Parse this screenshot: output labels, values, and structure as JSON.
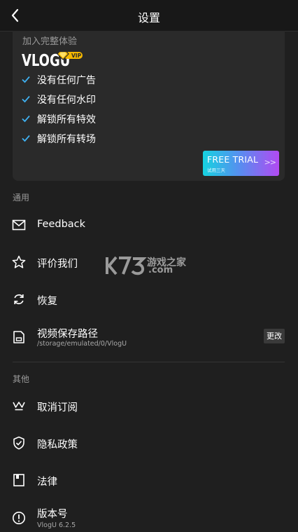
{
  "header": {
    "title": "设置"
  },
  "promo": {
    "label": "加入完整体验",
    "brand": "VLOGU",
    "vip": "VIP",
    "features": [
      "没有任何广告",
      "没有任何水印",
      "解锁所有特效",
      "解锁所有转场"
    ],
    "trial_title": "FREE TRIAL",
    "trial_sub": "试用三天",
    "trial_arrow": ">>"
  },
  "general": {
    "label": "通用",
    "feedback": "Feedback",
    "rate": "评价我们",
    "restore": "恢复",
    "save_path_label": "视频保存路径",
    "save_path_value": "/storage/emulated/0/VlogU",
    "change": "更改"
  },
  "other": {
    "label": "其他",
    "unsubscribe": "取消订阅",
    "privacy": "隐私政策",
    "legal": "法律",
    "version_label": "版本号",
    "version_value": "VlogU 6.2.5"
  },
  "watermark": {
    "text": "游戏之家",
    "com": ".com"
  },
  "colors": {
    "background": "#1f1f1f",
    "card": "#2a2a2a",
    "check": "#3fb0f0",
    "vip_gold": "#f5b800"
  }
}
